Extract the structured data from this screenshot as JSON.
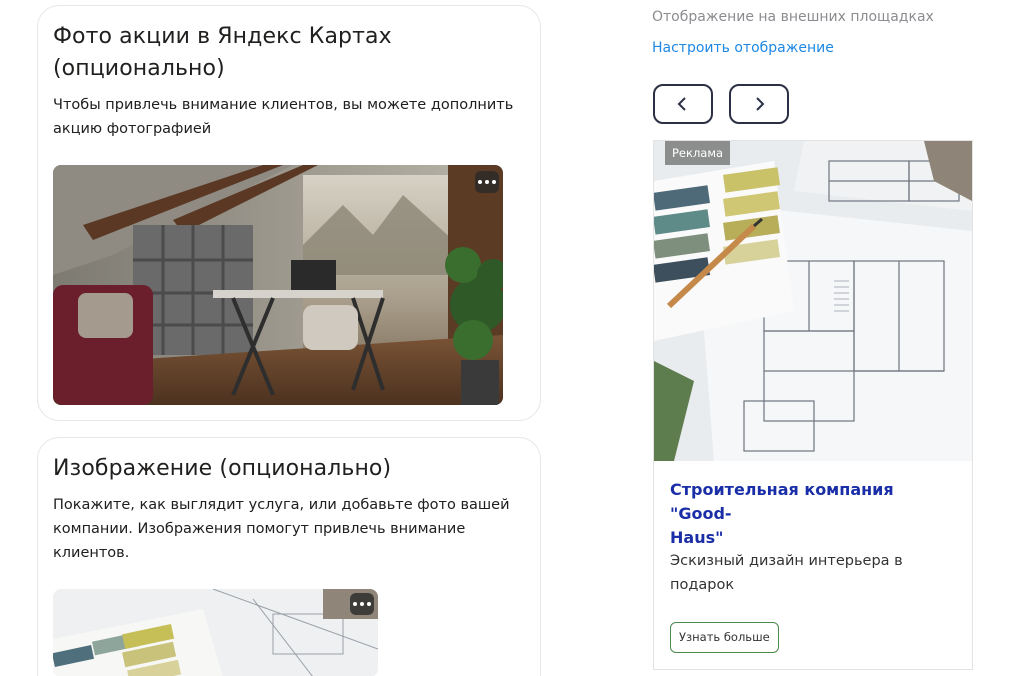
{
  "section_photo": {
    "title_line1": "Фото акции в Яндекс Картах",
    "title_line2": "(опционально)",
    "desc_line1": "Чтобы привлечь внимание клиентов, вы можете дополнить",
    "desc_line2": "акцию фотографией"
  },
  "section_image": {
    "title": "Изображение (опционально)",
    "desc_line1": "Покажите, как выглядит услуга, или добавьте фото вашей",
    "desc_line2": "компании. Изображения помогут привлечь внимание",
    "desc_line3": "клиентов."
  },
  "external": {
    "label": "Отображение на внешних площадках",
    "configure_link": "Настроить отображение"
  },
  "ad": {
    "badge": "Реклама",
    "title_line1": "Строительная компания \"Good-",
    "title_line2": "Haus\"",
    "text_line1": "Эскизный дизайн интерьера в",
    "text_line2": "подарок",
    "button": "Узнать больше"
  },
  "icons": {
    "prev": "chevron-left-icon",
    "next": "chevron-right-icon",
    "more": "more-dots-icon"
  },
  "colors": {
    "link": "#1e88e5",
    "ad_title": "#1a2ea8",
    "button_border": "#4c8a4c"
  }
}
